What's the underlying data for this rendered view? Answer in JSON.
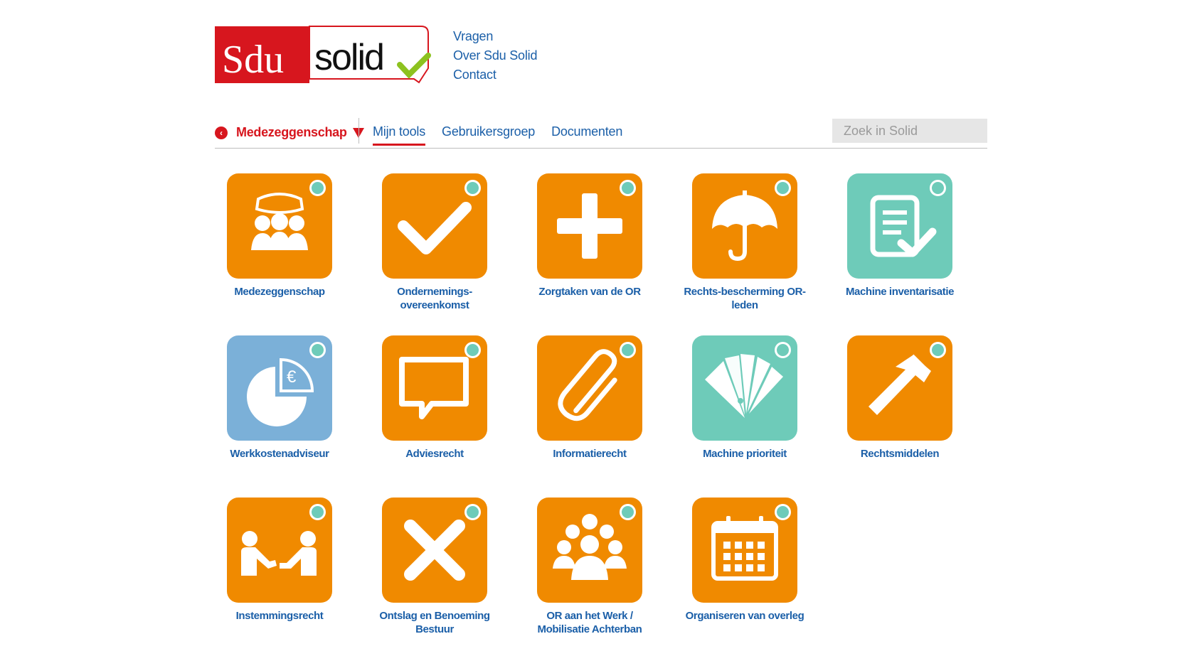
{
  "logo": {
    "left": "Sdu",
    "right": "solid"
  },
  "toplinks": [
    "Vragen",
    "Over Sdu Solid",
    "Contact"
  ],
  "nav": {
    "crumb_label": "Medezeggenschap",
    "tabs": [
      "Mijn tools",
      "Gebruikersgroep",
      "Documenten"
    ],
    "search_placeholder": "Zoek in Solid"
  },
  "colors": {
    "orange": "#f08a00",
    "teal": "#6ecbb9",
    "blue": "#7bb0d8",
    "brand_red": "#d7161e",
    "link_blue": "#1b5fa8"
  },
  "tiles": [
    {
      "label": "Medezeggenschap",
      "icon": "meeting-icon",
      "color": "orange"
    },
    {
      "label": "Ondernemings-overeenkomst",
      "icon": "checkmark-icon",
      "color": "orange"
    },
    {
      "label": "Zorgtaken van de OR",
      "icon": "plus-icon",
      "color": "orange"
    },
    {
      "label": "Rechts-bescherming OR-leden",
      "icon": "umbrella-icon",
      "color": "orange"
    },
    {
      "label": "Machine inventarisatie",
      "icon": "checklist-icon",
      "color": "teal"
    },
    {
      "label": "Werkkostenadviseur",
      "icon": "pie-euro-icon",
      "color": "blue"
    },
    {
      "label": "Adviesrecht",
      "icon": "speech-bubble-icon",
      "color": "orange"
    },
    {
      "label": "Informatierecht",
      "icon": "paperclip-icon",
      "color": "orange"
    },
    {
      "label": "Machine prioriteit",
      "icon": "fan-cards-icon",
      "color": "teal"
    },
    {
      "label": "Rechtsmiddelen",
      "icon": "hammer-icon",
      "color": "orange"
    },
    {
      "label": "Instemmingsrecht",
      "icon": "handshake-icon",
      "color": "orange"
    },
    {
      "label": "Ontslag en Benoeming Bestuur",
      "icon": "cross-icon",
      "color": "orange"
    },
    {
      "label": "OR aan het Werk / Mobilisatie Achterban",
      "icon": "group-icon",
      "color": "orange"
    },
    {
      "label": "Organiseren van overleg",
      "icon": "calendar-icon",
      "color": "orange"
    }
  ]
}
